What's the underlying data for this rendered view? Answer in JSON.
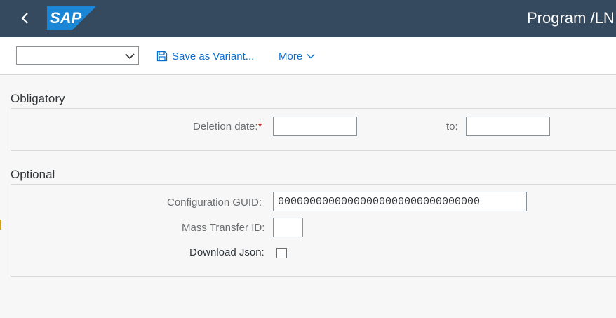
{
  "shell": {
    "title": "Program /LN",
    "logo_text": "SAP",
    "back_icon": "chevron-left-icon",
    "colors": {
      "shell_bg": "#354a5f",
      "logo_blue": "#1b86d6",
      "accent": "#0a6ed1"
    }
  },
  "toolbar": {
    "variant_value": "",
    "save_variant_label": "Save as Variant...",
    "more_label": "More"
  },
  "obligatory": {
    "title": "Obligatory",
    "deletion_date_label": "Deletion date:",
    "required_marker": "*",
    "deletion_date_from": "",
    "to_label": "to:",
    "deletion_date_to": ""
  },
  "optional": {
    "title": "Optional",
    "config_guid_label": "Configuration GUID:",
    "config_guid_value": "00000000000000000000000000000000",
    "mass_transfer_label": "Mass Transfer ID:",
    "mass_transfer_value": "",
    "download_json_label": "Download Json:",
    "download_json_checked": false
  }
}
